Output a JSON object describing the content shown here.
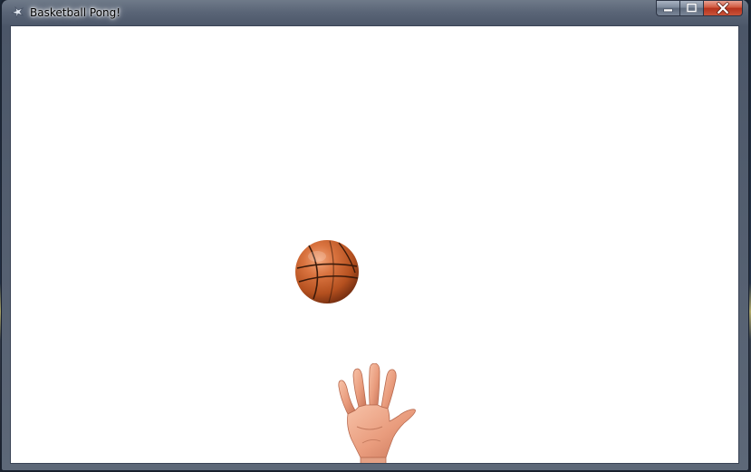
{
  "window": {
    "title": "Basketball Pong!",
    "icon": "app-icon",
    "buttons": {
      "minimize": "minimize-icon",
      "maximize": "maximize-icon",
      "close": "close-icon"
    }
  },
  "game": {
    "background": "#ffffff",
    "ball": {
      "icon": "basketball",
      "color": "#d2683a"
    },
    "paddle": {
      "icon": "hand",
      "color": "#f0a98c"
    }
  }
}
